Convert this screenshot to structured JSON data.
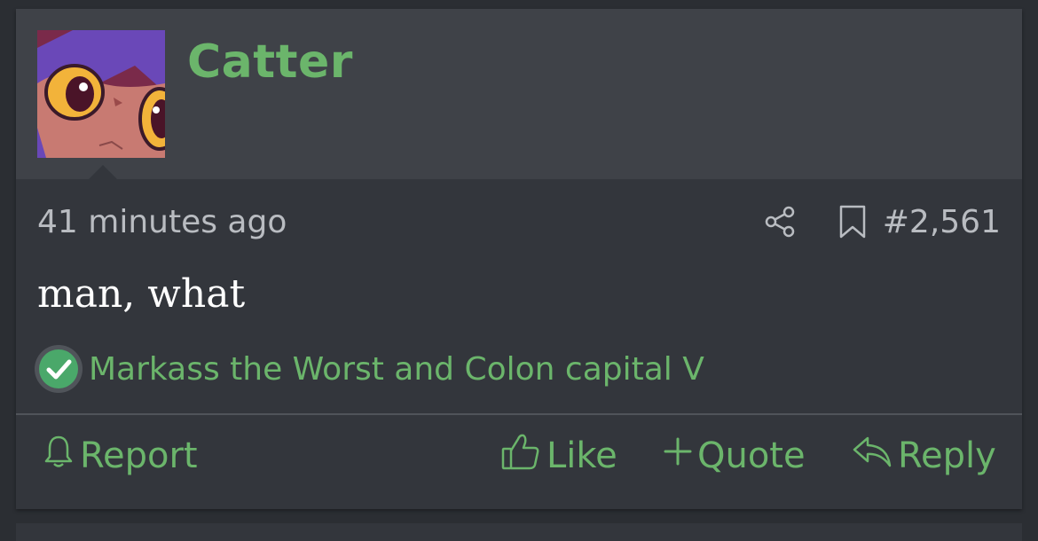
{
  "post": {
    "username": "Catter",
    "timestamp": "41 minutes ago",
    "post_number": "#2,561",
    "message": "man, what",
    "reactions": {
      "icon": "check-circle-icon",
      "users_text": "Markass the Worst and Colon capital V"
    },
    "actions": {
      "report_label": "Report",
      "like_label": "Like",
      "quote_label": "Quote",
      "reply_label": "Reply"
    }
  },
  "icons": {
    "share": "share-icon",
    "bookmark": "bookmark-icon",
    "report": "bell-icon",
    "like": "thumbs-up-icon",
    "quote": "plus-icon",
    "reply": "reply-arrow-icon"
  },
  "colors": {
    "accent": "#6bb56b",
    "header_bg": "#3f4248",
    "post_bg": "#33363c",
    "page_bg": "#2b2e33",
    "muted_text": "#b9bcc1"
  }
}
